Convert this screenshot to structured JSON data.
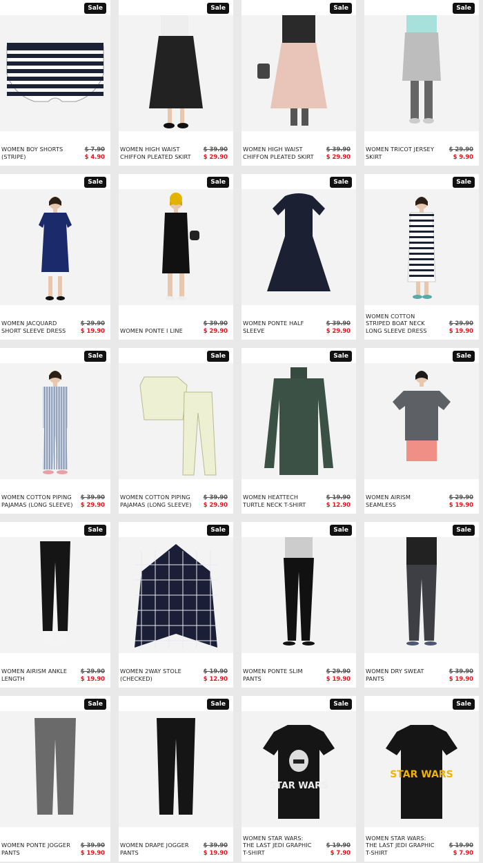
{
  "sale_badge": "Sale",
  "colors": {
    "sale_price": "#e8111b",
    "badge_bg": "#111111"
  },
  "products": [
    {
      "name": "WOMEN BOY SHORTS (STRIPE)",
      "old_price": "$ 7.90",
      "sale_price": "$ 4.90",
      "image": "striped-shorts"
    },
    {
      "name": "WOMEN HIGH WAIST CHIFFON PLEATED SKIRT",
      "old_price": "$ 39.90",
      "sale_price": "$ 29.90",
      "image": "black-pleated-skirt"
    },
    {
      "name": "WOMEN HIGH WAIST CHIFFON PLEATED SKIRT",
      "old_price": "$ 39.90",
      "sale_price": "$ 29.90",
      "image": "pink-pleated-skirt"
    },
    {
      "name": "WOMEN TRICOT JERSEY SKIRT",
      "old_price": "$ 29.90",
      "sale_price": "$ 9.90",
      "image": "grey-jersey-skirt"
    },
    {
      "name": "WOMEN JACQUARD SHORT SLEEVE DRESS",
      "old_price": "$ 29.90",
      "sale_price": "$ 19.90",
      "image": "navy-dress"
    },
    {
      "name": "WOMEN PONTE I LINE",
      "old_price": "$ 39.90",
      "sale_price": "$ 29.90",
      "image": "black-i-line-dress"
    },
    {
      "name": "WOMEN PONTE HALF SLEEVE",
      "old_price": "$ 39.90",
      "sale_price": "$ 29.90",
      "image": "navy-flare-dress"
    },
    {
      "name": "WOMEN COTTON STRIPED BOAT NECK LONG SLEEVE DRESS",
      "old_price": "$ 29.90",
      "sale_price": "$ 19.90",
      "image": "striped-dress"
    },
    {
      "name": "WOMEN COTTON PIPING PAJAMAS (LONG SLEEVE)",
      "old_price": "$ 39.90",
      "sale_price": "$ 29.90",
      "image": "striped-pajamas"
    },
    {
      "name": "WOMEN COTTON PIPING PAJAMAS (LONG SLEEVE)",
      "old_price": "$ 39.90",
      "sale_price": "$ 29.90",
      "image": "cream-pajamas"
    },
    {
      "name": "WOMEN HEATTECH TURTLE NECK T-SHIRT",
      "old_price": "$ 19.90",
      "sale_price": "$ 12.90",
      "image": "green-turtleneck"
    },
    {
      "name": "WOMEN AIRism SEAMLESS",
      "old_price": "$ 29.90",
      "sale_price": "$ 19.90",
      "image": "grey-tshirt"
    },
    {
      "name": "WOMEN AIRism ANKLE LENGTH",
      "old_price": "$ 29.90",
      "sale_price": "$ 19.90",
      "image": "black-leggings"
    },
    {
      "name": "WOMEN 2WAY STOLE (CHECKED)",
      "old_price": "$ 19.90",
      "sale_price": "$ 12.90",
      "image": "checked-stole"
    },
    {
      "name": "WOMEN PONTE SLIM PANTS",
      "old_price": "$ 29.90",
      "sale_price": "$ 19.90",
      "image": "black-slim-pants"
    },
    {
      "name": "WOMEN DRY SWEAT PANTS",
      "old_price": "$ 39.90",
      "sale_price": "$ 19.90",
      "image": "grey-sweat-pants"
    },
    {
      "name": "WOMEN PONTE JOGGER PANTS",
      "old_price": "$ 39.90",
      "sale_price": "$ 19.90",
      "image": "grey-jogger-pants"
    },
    {
      "name": "WOMEN DRAPE JOGGER PANTS",
      "old_price": "$ 39.90",
      "sale_price": "$ 19.90",
      "image": "black-jogger-pants"
    },
    {
      "name": "WOMEN STAR WARS: THE LAST JEDI GRAPHIC T-SHIRT",
      "old_price": "$ 19.90",
      "sale_price": "$ 7.90",
      "image": "stormtrooper-tshirt",
      "graphic_text": "STAR WARS"
    },
    {
      "name": "WOMEN STAR WARS: THE LAST JEDI GRAPHIC T-SHIRT",
      "old_price": "$ 19.90",
      "sale_price": "$ 7.90",
      "image": "star-wars-logo-tshirt",
      "graphic_text": "STAR WARS"
    }
  ]
}
